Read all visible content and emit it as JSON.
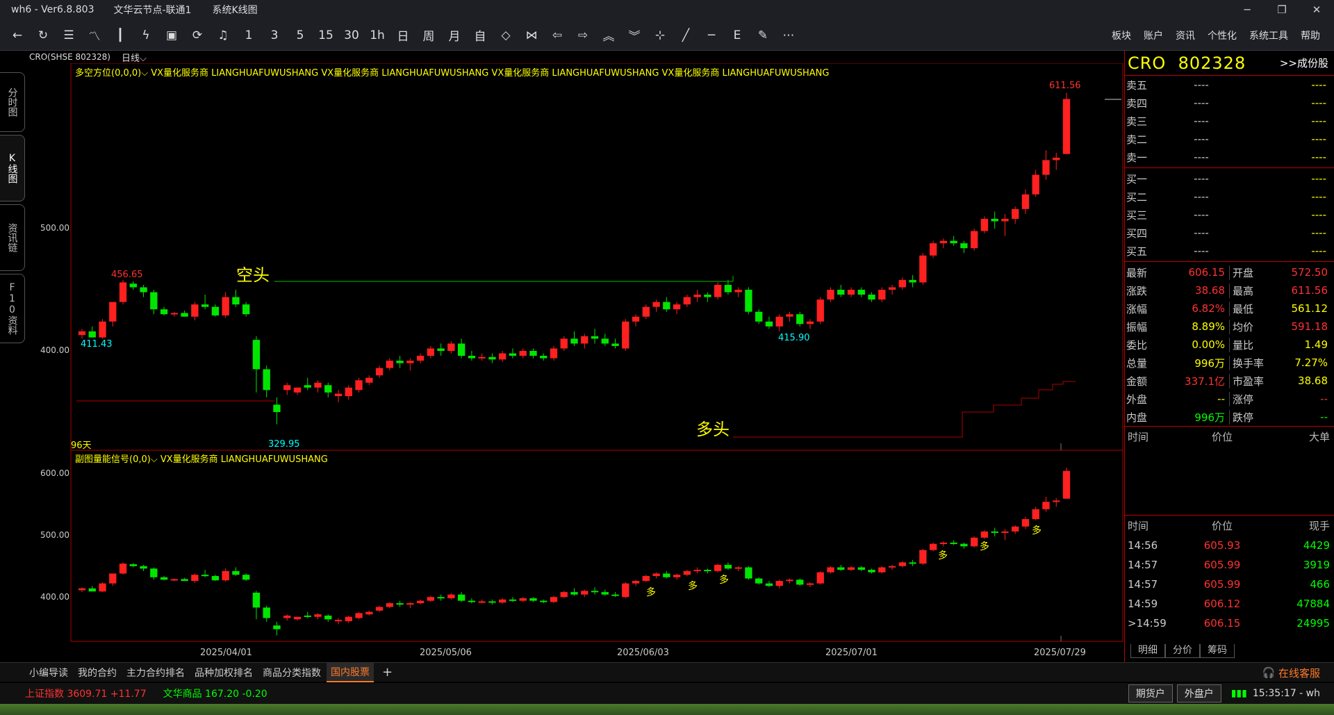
{
  "window": {
    "app": "wh6  -  Ver6.8.803",
    "server": "文华云节点-联通1",
    "view": "系统K线图",
    "controls": [
      "─",
      "❐",
      "✕"
    ]
  },
  "toolbar": {
    "icons": [
      "back-icon",
      "refresh-icon",
      "list-icon",
      "line-chart-icon",
      "candle-icon",
      "analysis-icon",
      "draw-icon",
      "cycle-icon",
      "bell-icon"
    ],
    "periods": [
      "1",
      "3",
      "5",
      "15",
      "30",
      "1h",
      "日",
      "周",
      "月",
      "自"
    ],
    "nav_icons": [
      "shrink-icon",
      "expand-icon",
      "prev-icon",
      "next-icon",
      "up-icon",
      "down-icon",
      "crosshair-icon",
      "line-tool-icon",
      "hline-tool-icon",
      "fib-icon",
      "eraser-icon",
      "more-icon"
    ],
    "menu": [
      "板块",
      "账户",
      "资讯",
      "个性化",
      "系统工具",
      "帮助"
    ]
  },
  "side_tabs": [
    "分时图",
    "K线图",
    "资讯链",
    "F10资料"
  ],
  "chart": {
    "symbol_label": "CRO(SHSE 802328)",
    "period": "日线",
    "main_indicator": "多空方位(0,0,0)",
    "sub_indicator": "副图量能信号(0,0)",
    "watermark_cn": "VX量化服务商",
    "watermark_en": "LIANGHUAFUWUSHANG",
    "main_axis": [
      "500.00",
      "400.00"
    ],
    "sub_axis": [
      "600.00",
      "500.00",
      "400.00"
    ],
    "labels": {
      "high1": "456.65",
      "low1": "411.43",
      "low2": "329.95",
      "low3": "415.90",
      "high2": "611.56",
      "days": "96天"
    },
    "bear_label": "空头",
    "bull_label": "多头",
    "signal_label": "多",
    "dates": [
      "2025/04/01",
      "2025/05/06",
      "2025/06/03",
      "2025/07/01",
      "2025/07/29"
    ]
  },
  "chart_data": {
    "type": "candlestick",
    "ylabel": "",
    "ylim": [
      315,
      625
    ],
    "candles": [
      [
        413,
        418,
        410,
        416
      ],
      [
        416,
        420,
        412,
        411
      ],
      [
        411,
        426,
        410,
        424
      ],
      [
        424,
        430,
        420,
        440
      ],
      [
        440,
        458,
        438,
        456
      ],
      [
        455,
        457,
        450,
        452
      ],
      [
        452,
        454,
        444,
        448
      ],
      [
        448,
        450,
        430,
        434
      ],
      [
        434,
        436,
        429,
        430
      ],
      [
        430,
        432,
        428,
        431
      ],
      [
        431,
        433,
        428,
        428
      ],
      [
        428,
        440,
        425,
        438
      ],
      [
        438,
        446,
        434,
        436
      ],
      [
        436,
        438,
        428,
        429
      ],
      [
        429,
        448,
        427,
        444
      ],
      [
        444,
        450,
        436,
        438
      ],
      [
        438,
        440,
        428,
        430
      ],
      [
        409,
        412,
        366,
        385
      ],
      [
        385,
        388,
        362,
        368
      ],
      [
        356,
        362,
        340,
        350
      ],
      [
        368,
        374,
        364,
        372
      ],
      [
        366,
        370,
        364,
        370
      ],
      [
        372,
        378,
        368,
        370
      ],
      [
        370,
        376,
        366,
        374
      ],
      [
        372,
        374,
        362,
        366
      ],
      [
        363,
        368,
        358,
        365
      ],
      [
        363,
        372,
        360,
        370
      ],
      [
        368,
        378,
        366,
        376
      ],
      [
        374,
        380,
        372,
        378
      ],
      [
        380,
        388,
        378,
        386
      ],
      [
        386,
        394,
        384,
        392
      ],
      [
        392,
        396,
        386,
        390
      ],
      [
        390,
        394,
        384,
        392
      ],
      [
        392,
        398,
        390,
        396
      ],
      [
        396,
        404,
        394,
        402
      ],
      [
        402,
        406,
        396,
        400
      ],
      [
        400,
        408,
        398,
        406
      ],
      [
        406,
        410,
        394,
        396
      ],
      [
        396,
        400,
        392,
        394
      ],
      [
        394,
        398,
        392,
        395
      ],
      [
        395,
        398,
        390,
        393
      ],
      [
        393,
        400,
        391,
        398
      ],
      [
        398,
        402,
        394,
        396
      ],
      [
        396,
        402,
        394,
        400
      ],
      [
        400,
        402,
        394,
        396
      ],
      [
        396,
        398,
        392,
        394
      ],
      [
        394,
        404,
        392,
        402
      ],
      [
        402,
        412,
        400,
        410
      ],
      [
        410,
        416,
        404,
        406
      ],
      [
        406,
        414,
        402,
        412
      ],
      [
        412,
        418,
        406,
        410
      ],
      [
        410,
        414,
        404,
        406
      ],
      [
        406,
        410,
        402,
        404
      ],
      [
        402,
        426,
        400,
        424
      ],
      [
        424,
        430,
        420,
        428
      ],
      [
        428,
        438,
        426,
        436
      ],
      [
        436,
        442,
        432,
        440
      ],
      [
        440,
        444,
        432,
        434
      ],
      [
        434,
        440,
        430,
        438
      ],
      [
        438,
        446,
        436,
        444
      ],
      [
        444,
        450,
        440,
        446
      ],
      [
        446,
        448,
        440,
        444
      ],
      [
        444,
        456,
        442,
        454
      ],
      [
        454,
        458,
        446,
        448
      ],
      [
        448,
        452,
        444,
        450
      ],
      [
        450,
        452,
        430,
        432
      ],
      [
        432,
        434,
        422,
        424
      ],
      [
        424,
        428,
        418,
        420
      ],
      [
        420,
        430,
        416,
        428
      ],
      [
        428,
        432,
        424,
        430
      ],
      [
        430,
        432,
        420,
        422
      ],
      [
        422,
        426,
        418,
        424
      ],
      [
        424,
        444,
        422,
        442
      ],
      [
        442,
        452,
        440,
        450
      ],
      [
        450,
        454,
        444,
        446
      ],
      [
        446,
        452,
        444,
        450
      ],
      [
        450,
        452,
        444,
        446
      ],
      [
        446,
        448,
        440,
        442
      ],
      [
        442,
        452,
        440,
        450
      ],
      [
        450,
        454,
        446,
        452
      ],
      [
        452,
        460,
        450,
        458
      ],
      [
        458,
        462,
        452,
        456
      ],
      [
        456,
        480,
        454,
        478
      ],
      [
        478,
        490,
        476,
        488
      ],
      [
        488,
        492,
        484,
        490
      ],
      [
        490,
        494,
        486,
        488
      ],
      [
        488,
        490,
        480,
        484
      ],
      [
        484,
        500,
        482,
        498
      ],
      [
        498,
        510,
        496,
        508
      ],
      [
        508,
        514,
        500,
        506
      ],
      [
        506,
        512,
        494,
        508
      ],
      [
        508,
        518,
        504,
        516
      ],
      [
        516,
        532,
        512,
        528
      ],
      [
        528,
        548,
        526,
        544
      ],
      [
        544,
        564,
        540,
        556
      ],
      [
        556,
        562,
        548,
        558
      ],
      [
        561,
        611,
        561,
        606
      ]
    ]
  },
  "quote": {
    "code": "CRO",
    "id": "802328",
    "link": ">>成份股",
    "asks": [
      {
        "k": "卖五",
        "p": "----",
        "v": "----"
      },
      {
        "k": "卖四",
        "p": "----",
        "v": "----"
      },
      {
        "k": "卖三",
        "p": "----",
        "v": "----"
      },
      {
        "k": "卖二",
        "p": "----",
        "v": "----"
      },
      {
        "k": "卖一",
        "p": "----",
        "v": "----"
      }
    ],
    "bids": [
      {
        "k": "买一",
        "p": "----",
        "v": "----"
      },
      {
        "k": "买二",
        "p": "----",
        "v": "----"
      },
      {
        "k": "买三",
        "p": "----",
        "v": "----"
      },
      {
        "k": "买四",
        "p": "----",
        "v": "----"
      },
      {
        "k": "买五",
        "p": "----",
        "v": "----"
      }
    ],
    "stats": [
      {
        "k1": "最新",
        "v1": "606.15",
        "c1": "red",
        "k2": "开盘",
        "v2": "572.50",
        "c2": "red"
      },
      {
        "k1": "涨跌",
        "v1": "38.68",
        "c1": "red",
        "k2": "最高",
        "v2": "611.56",
        "c2": "red"
      },
      {
        "k1": "涨幅",
        "v1": "6.82%",
        "c1": "red",
        "k2": "最低",
        "v2": "561.12",
        "c2": "yellow"
      },
      {
        "k1": "振幅",
        "v1": "8.89%",
        "c1": "yellow",
        "k2": "均价",
        "v2": "591.18",
        "c2": "red"
      },
      {
        "k1": "委比",
        "v1": "0.00%",
        "c1": "yellow",
        "k2": "量比",
        "v2": "1.49",
        "c2": "yellow"
      },
      {
        "k1": "总量",
        "v1": "996万",
        "c1": "yellow",
        "k2": "换手率",
        "v2": "7.27%",
        "c2": "yellow"
      },
      {
        "k1": "金额",
        "v1": "337.1亿",
        "c1": "red",
        "k2": "市盈率",
        "v2": "38.68",
        "c2": "yellow"
      },
      {
        "k1": "外盘",
        "v1": "--",
        "c1": "yellow",
        "k2": "涨停",
        "v2": "--",
        "c2": "red"
      },
      {
        "k1": "内盘",
        "v1": "996万",
        "c1": "green",
        "k2": "跌停",
        "v2": "--",
        "c2": "green"
      }
    ],
    "big_head": [
      "时间",
      "价位",
      "大单"
    ],
    "trade_head": [
      "时间",
      "价位",
      "现手"
    ],
    "trades": [
      {
        "t": "14:56",
        "p": "605.93",
        "v": "4429"
      },
      {
        "t": "14:57",
        "p": "605.99",
        "v": "3919"
      },
      {
        "t": "14:57",
        "p": "605.99",
        "v": "466"
      },
      {
        "t": "14:59",
        "p": "606.12",
        "v": "47884"
      },
      {
        "t": ">14:59",
        "p": "606.15",
        "v": "24995"
      }
    ],
    "tabs": [
      "明细",
      "分价",
      "筹码"
    ]
  },
  "bottom_tabs": [
    "小编导读",
    "我的合约",
    "主力合约排名",
    "品种加权排名",
    "商品分类指数",
    "国内股票"
  ],
  "bottom_active": "国内股票",
  "service": "在线客服",
  "status": {
    "idx1": "上证指数  3609.71  +11.77",
    "idx2": "文华商品  167.20  -0.20",
    "btn1": "期货户",
    "btn2": "外盘户",
    "clock": "15:35:17 - wh"
  },
  "colors": {
    "up": "#ff2020",
    "down": "#00e600",
    "border": "#b00000",
    "text_yellow": "#ffff00"
  }
}
